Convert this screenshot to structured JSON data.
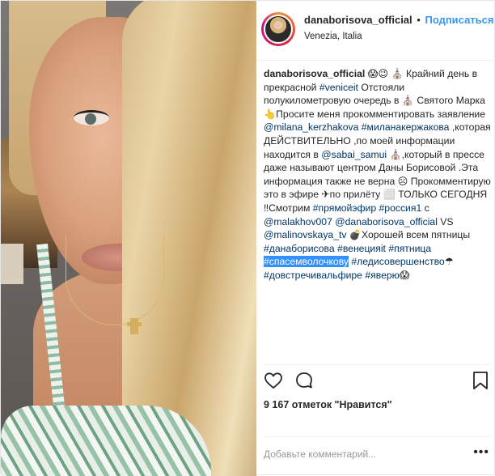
{
  "header": {
    "username": "danaborisova_official",
    "separator": "•",
    "follow_label": "Подписаться",
    "location": "Venezia, Italia"
  },
  "caption": {
    "username": "danaborisova_official",
    "p1": " 😱😉 ⛪ Крайний день в прекрасной ",
    "tag1": "#venicеit",
    "p2": " Отстояли полукилометровую очередь в ⛪ Святого Марка 👆Просите меня прокомментировать заявление ",
    "tag2": "@milana_kerzhakova",
    "p3": " ",
    "tag3": "#миланакержакова",
    "p4": " ,которая ДЕЙСТВИТЕЛЬНО ,по моей информации находится в ",
    "tag4": "@sabai_samui",
    "p5": " ⛪,который в прессе даже называют центром Даны Борисовой .Эта информация также не верна ☹ Прокомментирую это в эфире ✈по прилёту ⬜ ТОЛЬКО СЕГОДНЯ ‼Смотрим ",
    "tag5": "#прямойэфир",
    "p6": " ",
    "tag6": "#россия1",
    "p7": " с ",
    "tag7": "@malakhov007",
    "p8": " ",
    "tag8": "@danaborisova_official",
    "p9": " VS ",
    "tag9": "@malinovskaya_tv",
    "p10": " 💣Хорошей всем пятницы ",
    "tag10": "#данаборисова",
    "p11": " ",
    "tag11": "#венецияit",
    "p12": " ",
    "tag12": "#пятница",
    "p13": " ",
    "tag13": "#спасемволочкову",
    "p14": " ",
    "tag14": "#ледисовершенство",
    "p15": "☂ ",
    "tag15": "#довстречивальфире",
    "p16": " ",
    "tag16": "#яверю",
    "p17": "😱"
  },
  "actions": {
    "like_icon": "heart-icon",
    "comment_icon": "comment-icon",
    "save_icon": "bookmark-icon"
  },
  "likes": {
    "text": "9 167 отметок \"Нравится\""
  },
  "comment": {
    "placeholder": "Добавьте комментарий...",
    "more": "•••"
  }
}
